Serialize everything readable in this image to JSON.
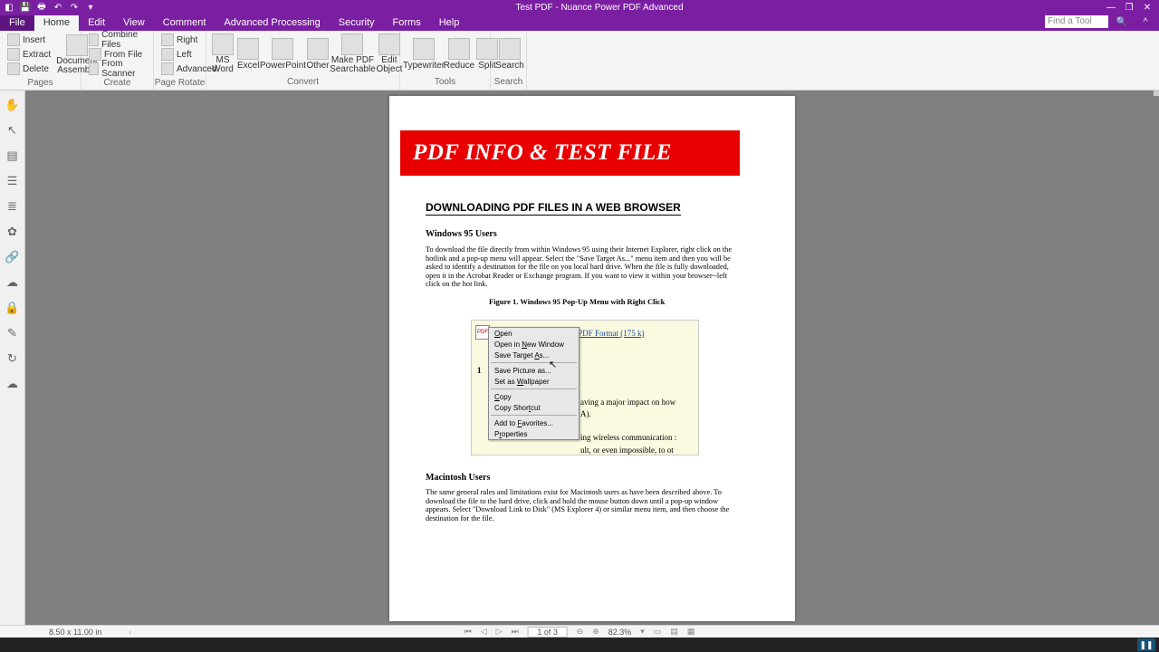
{
  "title": "Test PDF - Nuance Power PDF Advanced",
  "menutabs": {
    "file": "File",
    "home": "Home",
    "edit": "Edit",
    "view": "View",
    "comment": "Comment",
    "advanced": "Advanced Processing",
    "security": "Security",
    "forms": "Forms",
    "help": "Help"
  },
  "find_placeholder": "Find a Tool",
  "ribbon": {
    "pages": {
      "insert": "Insert",
      "extract": "Extract",
      "delete": "Delete",
      "doc_assembly": "Document\nAssembly",
      "group_label": "Pages"
    },
    "create": {
      "combine": "Combine Files",
      "fromfile": "From File",
      "fromscanner": "From Scanner",
      "group_label": "Create"
    },
    "rotate": {
      "right": "Right",
      "left": "Left",
      "advanced": "Advanced",
      "group_label": "Page Rotate"
    },
    "convert": {
      "msword": "MS\nWord",
      "excel": "Excel",
      "ppt": "PowerPoint",
      "other": "Other",
      "searchable": "Make PDF\nSearchable",
      "editobj": "Edit\nObject",
      "group_label": "Convert"
    },
    "tools": {
      "typewriter": "Typewriter",
      "reduce": "Reduce",
      "split": "Split",
      "group_label": "Tools"
    },
    "search": {
      "search": "Search",
      "group_label": "Search"
    }
  },
  "document": {
    "banner": "PDF INFO & TEST FILE",
    "heading1": "DOWNLOADING PDF FILES IN A WEB BROWSER",
    "sub1": "Windows 95 Users",
    "para1": "To download the file directly from within Windows 95 using their Internet Explorer, right click on the hotlink and a pop-up menu will appear. Select the \"Save Target As...\" menu item and then you will be asked to identify a destination for the file on you local hard drive. When the file is fully downloaded, open it in the Acrobat Reader or Exchange program. If you want to view it within your browser--left click on the hot link.",
    "figcaption": "Figure 1. Windows 95 Pop-Up Menu with Right Click",
    "figlink": "This article is available in PDF Format (175 k)",
    "fignum": "1",
    "figtext1": "aving a major impact on how",
    "figtext1b": "A).",
    "figtext2": "ing wireless communication :",
    "figtext3": "ult, or even impossible, to ot",
    "sub2": "Macintosh Users",
    "para2": "The same general rules and limitations exist for Macintosh users as have been described above. To download the file to the hard drive, click and hold the mouse button down until a pop-up window appears. Select \"Download Link to Disk\" (MS Explorer 4) or similar menu item, and then choose the destination for the file."
  },
  "context_menu": {
    "open": "Open",
    "open_new": "Open in New Window",
    "save_target": "Save Target As...",
    "save_picture": "Save Picture as...",
    "set_wallpaper": "Set as Wallpaper",
    "copy": "Copy",
    "copy_shortcut": "Copy Shortcut",
    "add_fav": "Add to Favorites...",
    "properties": "Properties"
  },
  "status": {
    "dims": "8.50 x 11.00 in",
    "page": "1 of 3",
    "zoom": "82.3%"
  }
}
